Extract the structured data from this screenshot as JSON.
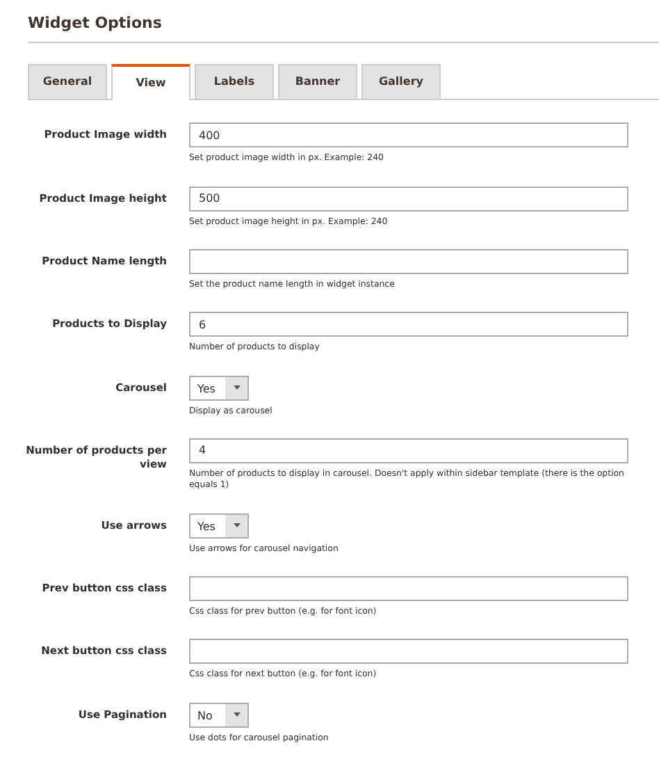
{
  "title": "Widget Options",
  "tabs": [
    {
      "label": "General",
      "selected": false
    },
    {
      "label": "View",
      "selected": true
    },
    {
      "label": "Labels",
      "selected": false
    },
    {
      "label": "Banner",
      "selected": false
    },
    {
      "label": "Gallery",
      "selected": false
    }
  ],
  "fields": [
    {
      "kind": "text",
      "label": "Product Image width",
      "value": "400",
      "note": "Set product image width in px. Example: 240"
    },
    {
      "kind": "text",
      "label": "Product Image height",
      "value": "500",
      "note": "Set product image height in px. Example: 240"
    },
    {
      "kind": "text",
      "label": "Product Name length",
      "note": "Set the product name length in widget instance"
    },
    {
      "kind": "text",
      "label": "Products to Display",
      "value": "6",
      "note": "Number of products to display"
    },
    {
      "kind": "select",
      "label": "Carousel",
      "value": "Yes",
      "note": "Display as carousel"
    },
    {
      "kind": "text",
      "label": "Number of products per view",
      "value": "4",
      "note": "Number of products to display in carousel. Doesn't apply within sidebar template (there is the option equals 1)"
    },
    {
      "kind": "select",
      "label": "Use arrows",
      "value": "Yes",
      "note": "Use arrows for carousel navigation"
    },
    {
      "kind": "text",
      "label": "Prev button css class",
      "note": "Css class for prev button (e.g. for font icon)"
    },
    {
      "kind": "text",
      "label": "Next button css class",
      "note": "Css class for next button (e.g. for font icon)"
    },
    {
      "kind": "select",
      "label": "Use Pagination",
      "value": "No",
      "note": "Use dots for carousel pagination"
    }
  ]
}
